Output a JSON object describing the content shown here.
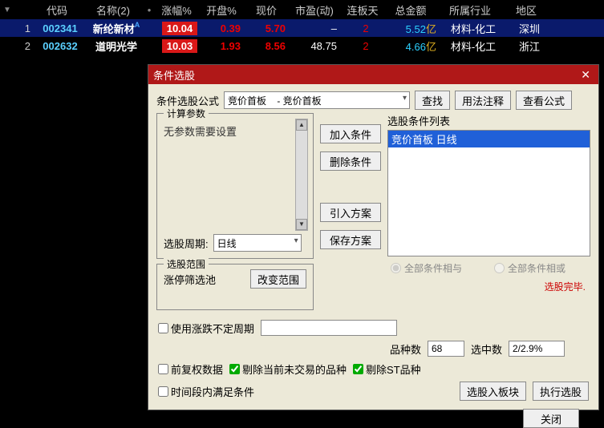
{
  "table": {
    "headers": [
      "代码",
      "名称(2)",
      "涨幅%",
      "开盘%",
      "现价",
      "市盈(动)",
      "连板天",
      "总金额",
      "所属行业",
      "地区"
    ],
    "rows": [
      {
        "idx": "1",
        "code": "002341",
        "name": "新纶新材",
        "sup": "A",
        "pct": "10.04",
        "open": "0.39",
        "price": "5.70",
        "pe": "–",
        "lb": "2",
        "amt": "5.52",
        "unit": "亿",
        "ind": "材料-化工",
        "reg": "深圳"
      },
      {
        "idx": "2",
        "code": "002632",
        "name": "道明光学",
        "sup": "",
        "pct": "10.03",
        "open": "1.93",
        "price": "8.56",
        "pe": "48.75",
        "lb": "2",
        "amt": "4.66",
        "unit": "亿",
        "ind": "材料-化工",
        "reg": "浙江"
      }
    ]
  },
  "dialog": {
    "title": "条件选股",
    "formula_label": "条件选股公式",
    "formula_value": "竞价首板    - 竞价首板",
    "btn_find": "查找",
    "btn_usage": "用法注释",
    "btn_view": "查看公式",
    "fs_params": "计算参数",
    "no_params": "无参数需要设置",
    "period_label": "选股周期:",
    "period_value": "日线",
    "btn_add": "加入条件",
    "btn_del": "删除条件",
    "btn_import": "引入方案",
    "btn_save": "保存方案",
    "list_label": "选股条件列表",
    "list_item": "竞价首板  日线",
    "radio_and": "全部条件相与",
    "radio_or": "全部条件相或",
    "done": "选股完毕.",
    "fs_range": "选股范围",
    "range_pool": "涨停筛选池",
    "btn_change_range": "改变范围",
    "chk_custom_period": "使用涨跌不定周期",
    "variety_label": "品种数",
    "variety_val": "68",
    "selected_label": "选中数",
    "selected_val": "2/2.9%",
    "chk_qfq": "前复权数据",
    "chk_exclude_notrade": "剔除当前未交易的品种",
    "chk_exclude_st": "剔除ST品种",
    "chk_time_range": "时间段内满足条件",
    "btn_into_block": "选股入板块",
    "btn_run": "执行选股",
    "btn_close": "关闭"
  }
}
